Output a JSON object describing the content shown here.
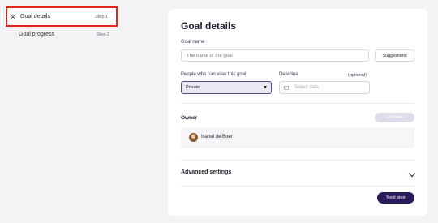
{
  "steps": [
    {
      "label": "Goal details",
      "step": "Step 1"
    },
    {
      "label": "Goal progress",
      "step": "Step 2"
    }
  ],
  "form": {
    "title": "Goal details",
    "goal_name_label": "Goal name",
    "goal_name_placeholder": "The name of the goal",
    "suggestions_label": "Suggestions",
    "visibility_label": "People who can view this goal",
    "visibility_value": "Private",
    "deadline_label": "Deadline",
    "deadline_optional": "(optional)",
    "deadline_placeholder": "Select date",
    "owner_label": "Owner",
    "add_owner_label": "Add owner",
    "owner_name": "Isabel de Boer",
    "advanced_label": "Advanced settings",
    "next_label": "Next step"
  },
  "colors": {
    "highlight_border": "#e0251b",
    "primary": "#2b1a5c",
    "select_border": "#5c4a86"
  }
}
